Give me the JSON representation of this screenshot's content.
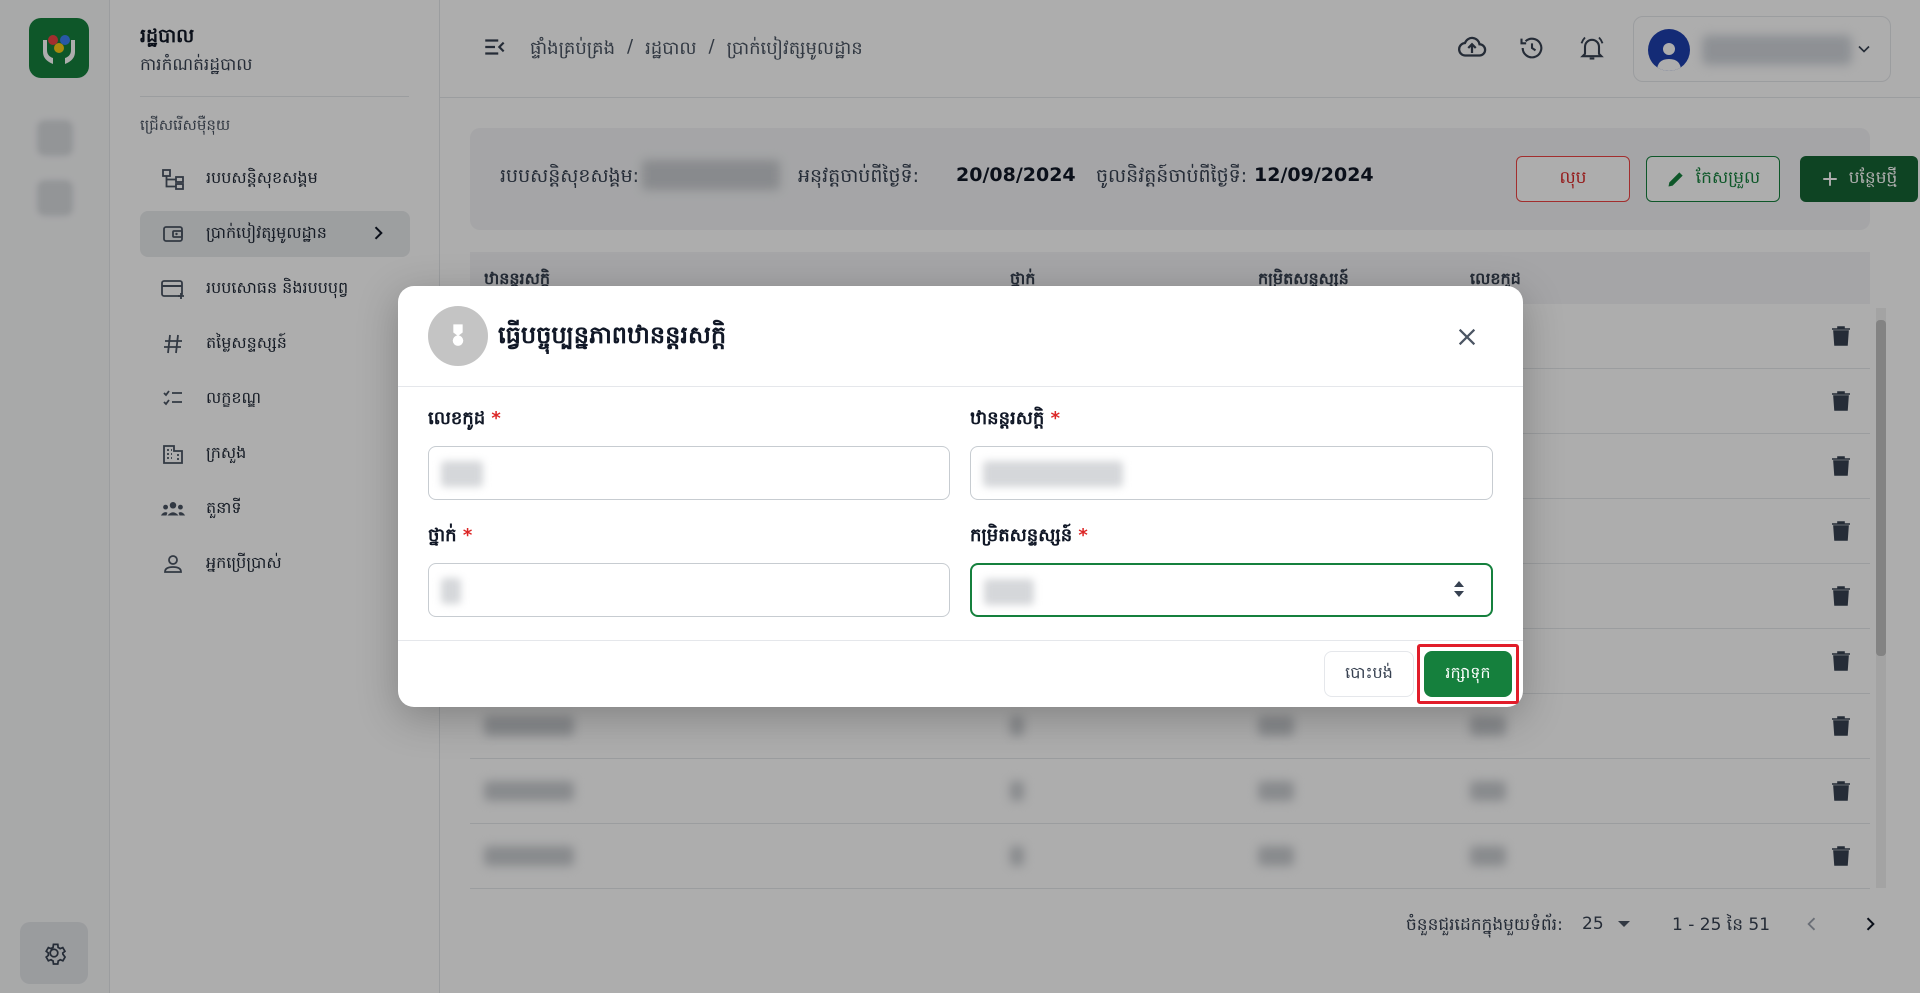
{
  "sidebar": {
    "title": "រដ្ឋបាល",
    "subtitle": "ការកំណត់រដ្ឋបាល",
    "section_label": "ជ្រើសរើសម៉ឺនុយ",
    "items": [
      {
        "label": "របបសន្តិសុខសង្គម",
        "icon": "hierarchy-icon"
      },
      {
        "label": "ប្រាក់បៀវត្សមូលដ្ឋាន",
        "icon": "wallet-icon",
        "active": true
      },
      {
        "label": "របបសោធន និងរបបបុព្វ",
        "icon": "card-plus-icon"
      },
      {
        "label": "តម្លៃសន្ទស្សន៍",
        "icon": "hash-icon"
      },
      {
        "label": "លក្ខខណ្ឌ",
        "icon": "checklist-icon"
      },
      {
        "label": "ក្រសួង",
        "icon": "building-icon"
      },
      {
        "label": "តួនាទី",
        "icon": "group-icon"
      },
      {
        "label": "អ្នកប្រើប្រាស់",
        "icon": "person-icon"
      }
    ]
  },
  "header": {
    "breadcrumb": [
      "ផ្ទាំងគ្រប់គ្រង",
      "/",
      "រដ្ឋបាល",
      "/",
      "ប្រាក់បៀវត្សមូលដ្ឋាន"
    ]
  },
  "info": {
    "scheme_label": "របបសន្តិសុខសង្គម:",
    "approved_label": "អនុវត្តចាប់ពីថ្ងៃទី:",
    "approved_date": "20/08/2024",
    "effective_label": "ចូលនិវត្តន៍ចាប់ពីថ្ងៃទី:",
    "effective_date": "12/09/2024",
    "delete_label": "លុប",
    "edit_label": "កែសម្រួល",
    "new_label": "បន្ថែមថ្មី"
  },
  "table": {
    "columns": [
      "ឋានន្តរសក្តិ",
      "ថ្នាក់",
      "កម្រិតសន្ទស្សន៍",
      "លេខកូដ"
    ]
  },
  "pagination": {
    "rows_per_page_label": "ចំនួនជួរដេកក្នុងមួយទំព័រ:",
    "rows_per_page": "25",
    "range": "1 - 25 នៃ 51"
  },
  "dialog": {
    "title": "ធ្វើបច្ចុប្បន្នភាពឋានន្តរសក្តិ",
    "fields": {
      "code_label": "លេខកូដ",
      "rank_label": "ឋានន្តរសក្តិ",
      "class_label": "ថ្នាក់",
      "index_label": "កម្រិតសន្ទស្សន៍",
      "required_mark": "*"
    },
    "cancel_label": "បោះបង់",
    "save_label": "រក្សាទុក"
  },
  "colors": {
    "primary": "#15803d",
    "danger": "#dc2626",
    "highlight": "#e11d2a"
  }
}
